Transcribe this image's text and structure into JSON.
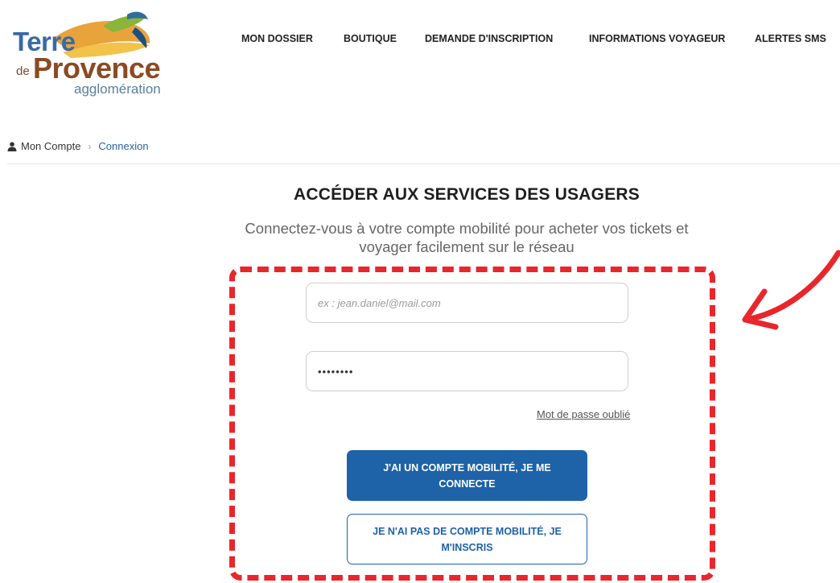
{
  "logo": {
    "line1": "Terre",
    "line2_small": "de",
    "line2": "Provence",
    "line3": "agglomération",
    "colors": {
      "blue": "#3a6aa5",
      "brown": "#8b4a23",
      "orange": "#e8a33a",
      "green": "#8bb43a"
    }
  },
  "nav": {
    "items": [
      {
        "label": "MON DOSSIER"
      },
      {
        "label": "BOUTIQUE"
      },
      {
        "label": "DEMANDE D'INSCRIPTION"
      },
      {
        "label": "INFORMATIONS VOYAGEUR"
      },
      {
        "label": "ALERTES SMS"
      }
    ]
  },
  "breadcrumb": {
    "icon": "user-icon",
    "home": "Mon Compte",
    "separator": "›",
    "current": "Connexion"
  },
  "main": {
    "title": "ACCÉDER AUX SERVICES DES USAGERS",
    "subtitle": "Connectez-vous à votre compte mobilité pour acheter vos tickets et voyager facilement sur le réseau"
  },
  "form": {
    "email_placeholder": "ex : jean.daniel@mail.com",
    "password_value": "••••••••",
    "forgot_link": "Mot de passe oublié",
    "login_button": "J'AI UN COMPTE MOBILITÉ, JE ME CONNECTE",
    "register_button": "JE N'AI PAS DE COMPTE MOBILITÉ, JE M'INSCRIS"
  },
  "colors": {
    "accent": "#1e62a8",
    "breadcrumb_link": "#2b5f9c",
    "annotation_red": "#e8262b"
  }
}
